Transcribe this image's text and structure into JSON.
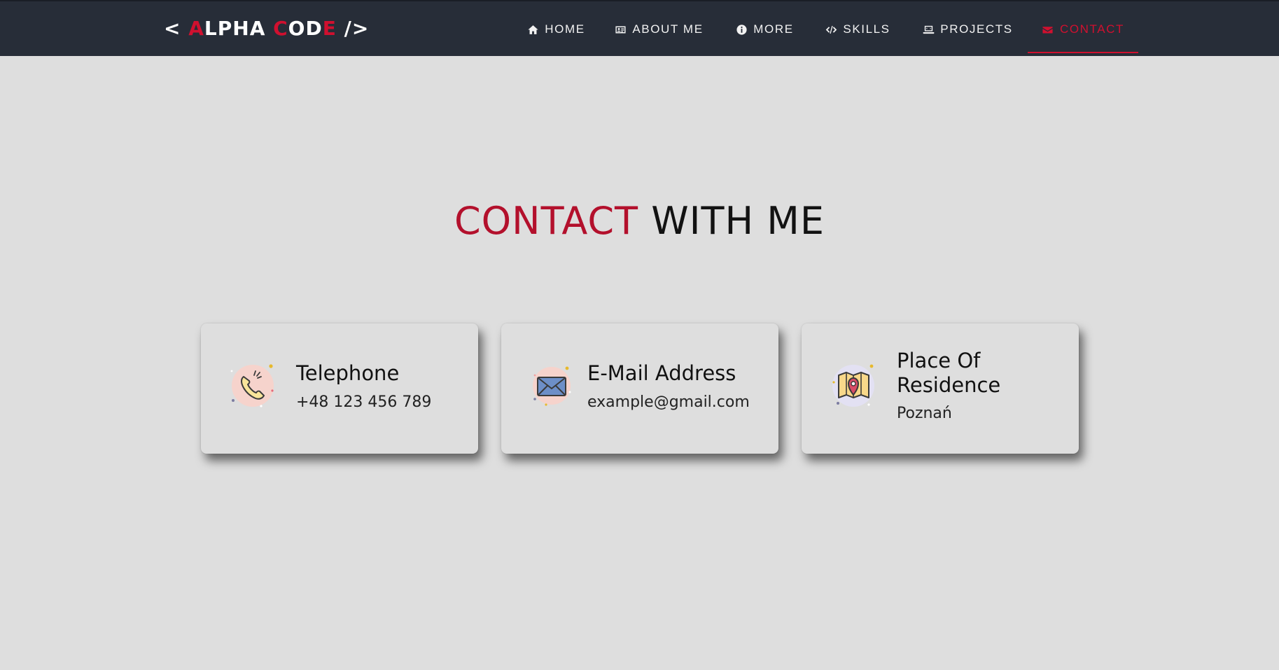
{
  "brand": {
    "parts": [
      {
        "text": "< ",
        "accent": false
      },
      {
        "text": "A",
        "accent": true
      },
      {
        "text": "LPHA ",
        "accent": false
      },
      {
        "text": "C",
        "accent": true
      },
      {
        "text": "OD",
        "accent": false
      },
      {
        "text": "E",
        "accent": true
      },
      {
        "text": " />",
        "accent": false
      }
    ],
    "accent_color": "#d0102f"
  },
  "nav": {
    "items": [
      {
        "label": "HOME",
        "icon": "home-icon",
        "active": false
      },
      {
        "label": "ABOUT ME",
        "icon": "id-card-icon",
        "active": false
      },
      {
        "label": "MORE",
        "icon": "info-icon",
        "active": false
      },
      {
        "label": "SKILLS",
        "icon": "code-icon",
        "active": false
      },
      {
        "label": "PROJECTS",
        "icon": "laptop-icon",
        "active": false
      },
      {
        "label": "CONTACT",
        "icon": "envelope-icon",
        "active": true
      }
    ],
    "active_color": "#d0102f",
    "background": "#272d38"
  },
  "section": {
    "title_highlight": "CONTACT",
    "title_rest": "WITH ME",
    "highlight_color": "#b3102c"
  },
  "cards": [
    {
      "icon": "telephone-icon",
      "title": "Telephone",
      "value": "+48 123 456 789"
    },
    {
      "icon": "envelope-icon",
      "title": "E-Mail Address",
      "value": "example@gmail.com"
    },
    {
      "icon": "map-pin-icon",
      "title": "Place Of Residence",
      "value": "Poznań"
    }
  ]
}
